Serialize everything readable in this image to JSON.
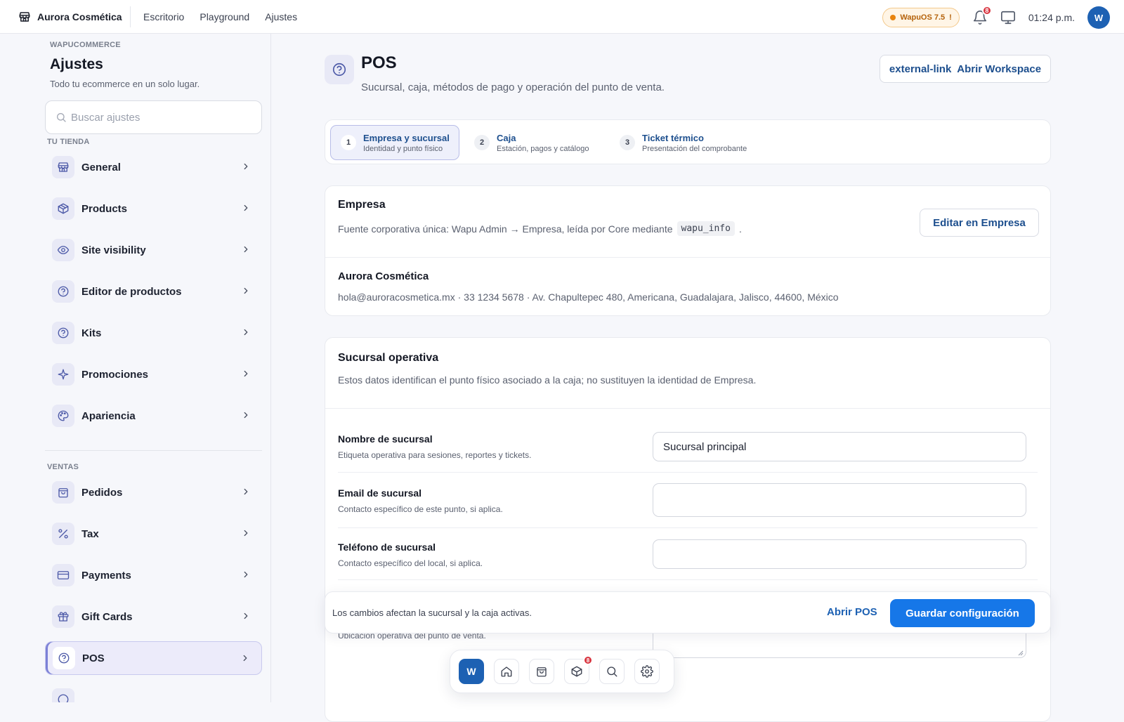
{
  "topbar": {
    "store_name": "Aurora Cosmética",
    "nav": [
      "Escritorio",
      "Playground",
      "Ajustes"
    ],
    "version_pill": "WapuOS 7.5",
    "version_warn": "!",
    "notifications_count": "8",
    "clock": "01:24 p.m.",
    "avatar_initial": "W"
  },
  "sidebar": {
    "eyebrow": "WAPUCOMMERCE",
    "title": "Ajustes",
    "subtitle": "Todo tu ecommerce en un solo lugar.",
    "search_placeholder": "Buscar ajustes",
    "group_store": "TU TIENDA",
    "store_items": [
      {
        "label": "General",
        "icon": "store-icon"
      },
      {
        "label": "Products",
        "icon": "box-icon"
      },
      {
        "label": "Site visibility",
        "icon": "eye-icon"
      },
      {
        "label": "Editor de productos",
        "icon": "help-icon"
      },
      {
        "label": "Kits",
        "icon": "help-icon"
      },
      {
        "label": "Promociones",
        "icon": "sparkle-icon"
      },
      {
        "label": "Apariencia",
        "icon": "palette-icon"
      }
    ],
    "group_sales": "VENTAS",
    "sales_items": [
      {
        "label": "Pedidos",
        "icon": "bag-icon"
      },
      {
        "label": "Tax",
        "icon": "percent-icon"
      },
      {
        "label": "Payments",
        "icon": "card-icon"
      },
      {
        "label": "Gift Cards",
        "icon": "gift-icon"
      },
      {
        "label": "POS",
        "icon": "help-icon",
        "active": true
      }
    ]
  },
  "page": {
    "title": "POS",
    "subtitle": "Sucursal, caja, métodos de pago y operación del punto de venta.",
    "workspace_icon_text": "external-link",
    "workspace_label": "Abrir Workspace"
  },
  "steps": [
    {
      "num": "1",
      "title": "Empresa y sucursal",
      "desc": "Identidad y punto físico",
      "active": true
    },
    {
      "num": "2",
      "title": "Caja",
      "desc": "Estación, pagos y catálogo"
    },
    {
      "num": "3",
      "title": "Ticket térmico",
      "desc": "Presentación del comprobante"
    }
  ],
  "empresa": {
    "title": "Empresa",
    "desc_before": "Fuente corporativa única: Wapu Admin → Empresa, leída por Core mediante",
    "desc_code": "wapu_info",
    "desc_after": ".",
    "edit_button": "Editar en Empresa",
    "company_name": "Aurora Cosmética",
    "company_details": "hola@auroracosmetica.mx · 33 1234 5678 · Av. Chapultepec 480, Americana, Guadalajara, Jalisco, 44600, México"
  },
  "sucursal": {
    "title": "Sucursal operativa",
    "desc": "Estos datos identifican el punto físico asociado a la caja; no sustituyen la identidad de Empresa.",
    "fields": [
      {
        "label": "Nombre de sucursal",
        "desc": "Etiqueta operativa para sesiones, reportes y tickets.",
        "value": "Sucursal principal"
      },
      {
        "label": "Email de sucursal",
        "desc": "Contacto específico de este punto, si aplica.",
        "value": ""
      },
      {
        "label": "Teléfono de sucursal",
        "desc": "Contacto específico del local, si aplica.",
        "value": ""
      }
    ],
    "address_desc": "Ubicación operativa del punto de venta."
  },
  "savebar": {
    "message": "Los cambios afectan la sucursal y la caja activas.",
    "open_pos": "Abrir POS",
    "save": "Guardar configuración"
  },
  "dock": {
    "initial": "W",
    "items": [
      "home-icon",
      "bag-icon",
      "box-icon",
      "search-icon",
      "gear-icon"
    ],
    "box_badge": "8"
  },
  "colors": {
    "accent": "#1677e8",
    "brand_blue": "#1d61b3",
    "badge_red": "#d8343f",
    "warning_orange": "#e8840f"
  }
}
